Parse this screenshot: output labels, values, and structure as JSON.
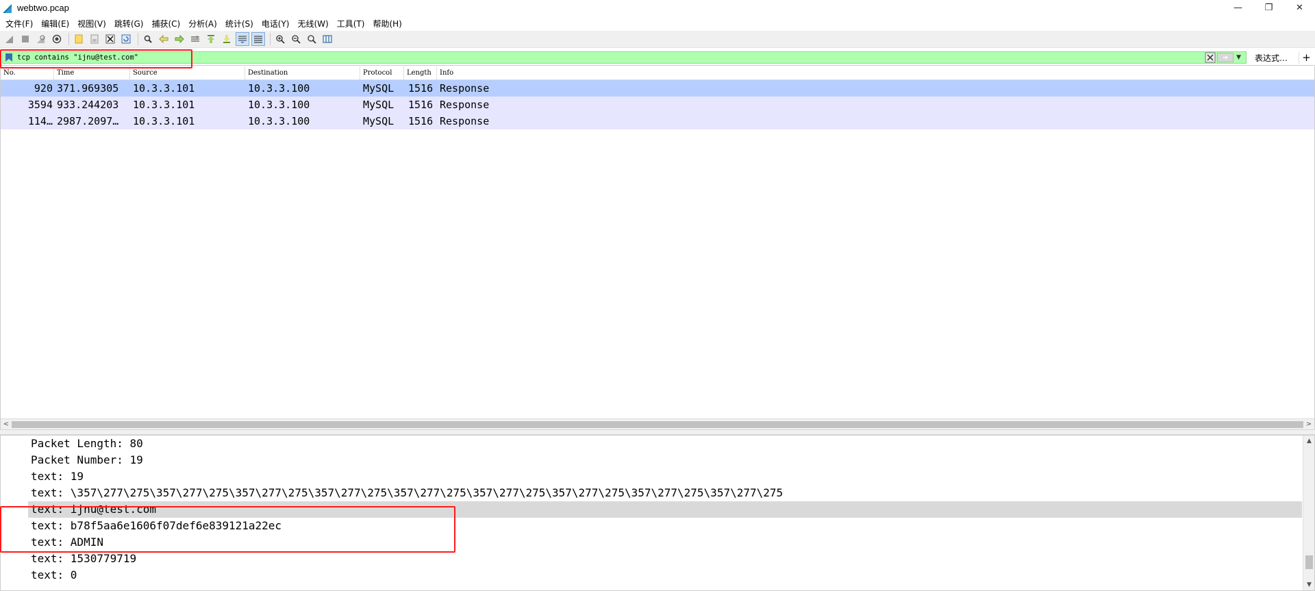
{
  "window": {
    "title": "webtwo.pcap",
    "controls": {
      "minimize": "—",
      "restore": "❐",
      "close": "✕"
    }
  },
  "menubar": {
    "items": [
      "文件(F)",
      "编辑(E)",
      "视图(V)",
      "跳转(G)",
      "捕获(C)",
      "分析(A)",
      "统计(S)",
      "电话(Y)",
      "无线(W)",
      "工具(T)",
      "帮助(H)"
    ]
  },
  "toolbar": {
    "icons": [
      "start-capture-icon",
      "stop-capture-icon",
      "restart-capture-icon",
      "capture-options-icon",
      "open-file-icon",
      "save-file-icon",
      "close-file-icon",
      "reload-file-icon",
      "find-packet-icon",
      "go-back-icon",
      "go-forward-icon",
      "go-to-packet-icon",
      "go-first-icon",
      "go-last-icon",
      "autoscroll-icon",
      "colorize-icon",
      "zoom-in-icon",
      "zoom-out-icon",
      "zoom-normal-icon",
      "resize-columns-icon"
    ]
  },
  "filter": {
    "value": "tcp contains \"ijnu@test.com\"",
    "expression_label": "表达式…",
    "add_label": "+",
    "background_color": "#afffaf"
  },
  "packet_list": {
    "columns": [
      "No.",
      "Time",
      "Source",
      "Destination",
      "Protocol",
      "Length",
      "Info"
    ],
    "rows": [
      {
        "no": "920",
        "time": "371.969305",
        "source": "10.3.3.101",
        "destination": "10.3.3.100",
        "protocol": "MySQL",
        "length": "1516",
        "info": "Response",
        "selected": true
      },
      {
        "no": "3594",
        "time": "933.244203",
        "source": "10.3.3.101",
        "destination": "10.3.3.100",
        "protocol": "MySQL",
        "length": "1516",
        "info": "Response",
        "selected": false
      },
      {
        "no": "114…",
        "time": "2987.2097…",
        "source": "10.3.3.101",
        "destination": "10.3.3.100",
        "protocol": "MySQL",
        "length": "1516",
        "info": "Response",
        "selected": false
      }
    ],
    "selected_row_color": "#b5ceff",
    "row_color": "#e7e6ff"
  },
  "details": {
    "lines": [
      "Packet Length: 80",
      "Packet Number: 19",
      "text: 19",
      "text: \\357\\277\\275\\357\\277\\275\\357\\277\\275\\357\\277\\275\\357\\277\\275\\357\\277\\275\\357\\277\\275\\357\\277\\275\\357\\277\\275",
      "text: ijnu@test.com",
      "text: b78f5aa6e1606f07def6e839121a22ec",
      "text: ADMIN",
      "text: 1530779719",
      "text: 0"
    ],
    "highlighted_line_index": 4,
    "highlight_color": "#d9d9d9"
  },
  "annotation_color": "#ff1a1a"
}
